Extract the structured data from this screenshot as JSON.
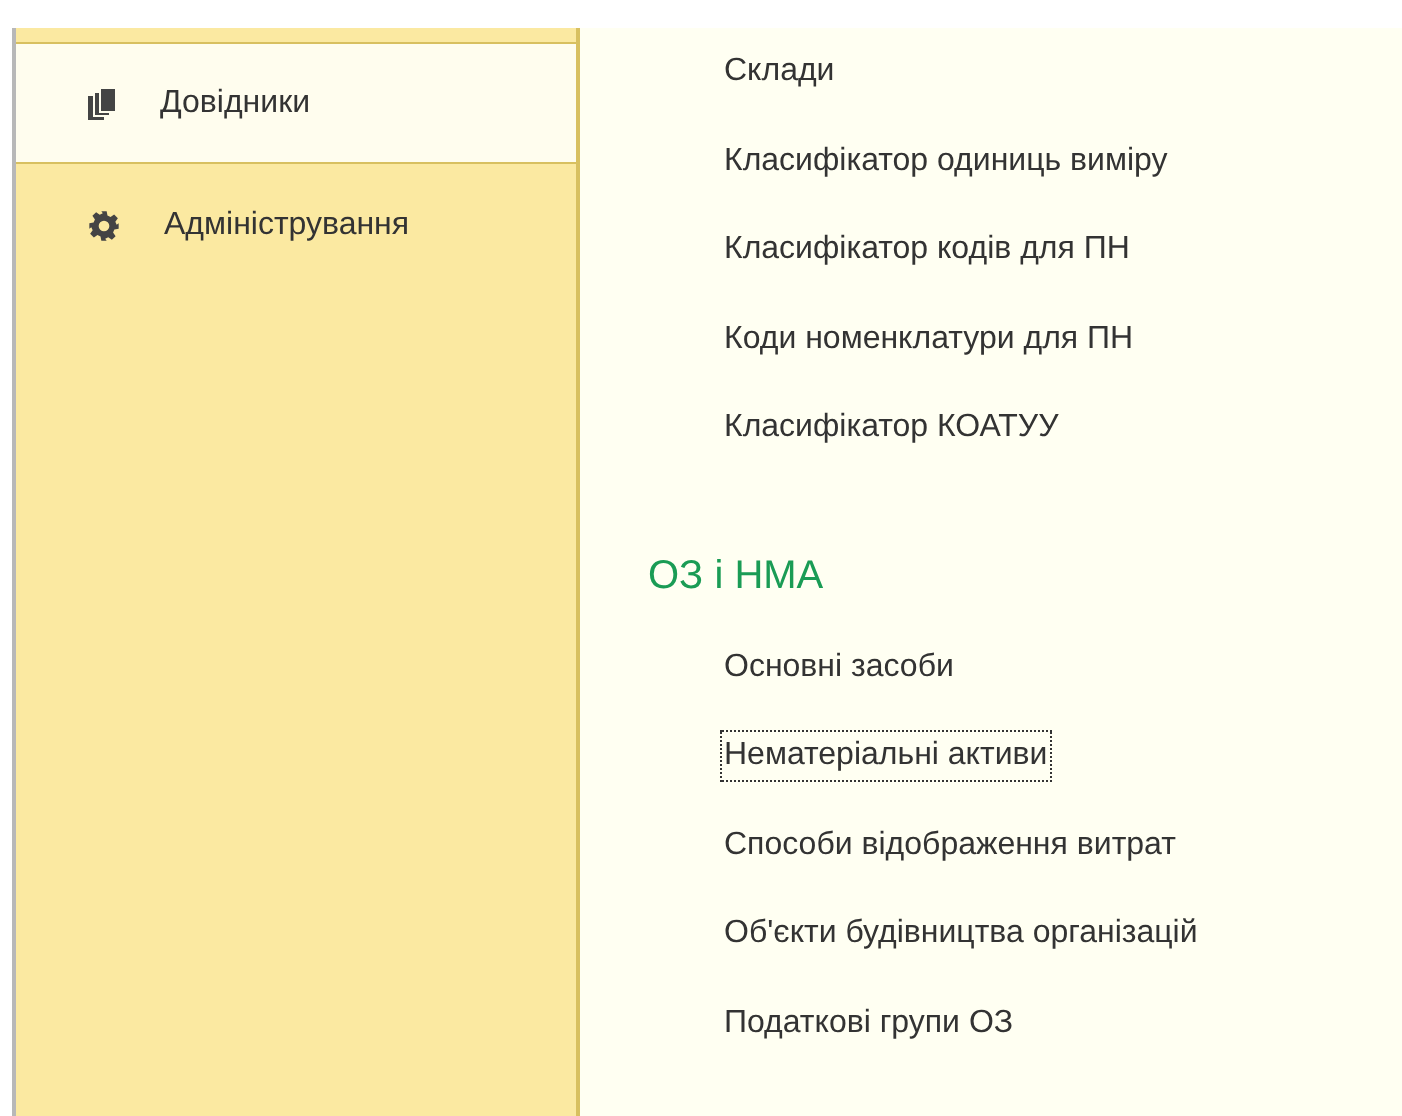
{
  "sidebar": {
    "items": [
      {
        "label": "Довідники",
        "kind": "books",
        "selected": true
      },
      {
        "label": "Адміністрування",
        "kind": "gear",
        "selected": false
      }
    ]
  },
  "sections": [
    {
      "items": [
        {
          "label": "Склади",
          "focused": false
        },
        {
          "label": "Класифікатор одиниць виміру",
          "focused": false
        },
        {
          "label": "Класифікатор кодів для ПН",
          "focused": false
        },
        {
          "label": "Коди номенклатури для ПН",
          "focused": false
        },
        {
          "label": "Класифікатор КОАТУУ",
          "focused": false
        }
      ]
    },
    {
      "title": "ОЗ і НМА",
      "items": [
        {
          "label": "Основні засоби",
          "focused": false
        },
        {
          "label": "Нематеріальні активи",
          "focused": true
        },
        {
          "label": "Способи відображення витрат",
          "focused": false
        },
        {
          "label": "Об'єкти будівництва організацій",
          "focused": false
        },
        {
          "label": "Податкові групи ОЗ",
          "focused": false
        }
      ]
    }
  ]
}
